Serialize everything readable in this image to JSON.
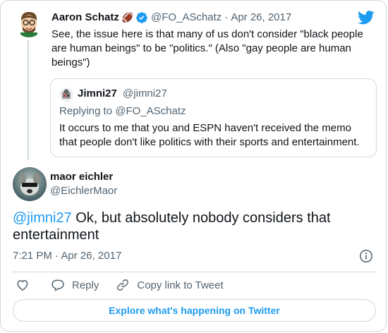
{
  "parent_tweet": {
    "author_name": "Aaron Schatz",
    "author_emoji": "🏈",
    "verified": true,
    "handle": "@FO_ASchatz",
    "separator": "·",
    "date": "Apr 26, 2017",
    "text": "See, the issue here is that many of us don't consider \"black people are human beings\" to be \"politics.\" (Also \"gay people are human beings\")"
  },
  "quoted_tweet": {
    "author_name": "Jimni27",
    "handle": "@jimni27",
    "replying_prefix": "Replying to",
    "replying_to": "@FO_ASchatz",
    "text": "It occurs to me that you and ESPN haven't received the memo that people don't like politics with their sports and entertainment."
  },
  "main_tweet": {
    "author_name": "maor eichler",
    "handle": "@EichlerMaor",
    "mention": "@jimni27",
    "text": " Ok, but absolutely nobody considers that entertainment",
    "time": "7:21 PM",
    "separator": "·",
    "date": "Apr 26, 2017"
  },
  "actions": {
    "reply_label": "Reply",
    "copy_link_label": "Copy link to Tweet"
  },
  "explore_label": "Explore what's happening on Twitter",
  "colors": {
    "accent": "#1d9bf0",
    "text": "#0f1419",
    "muted": "#536471",
    "border": "#cfd9de"
  },
  "icons": [
    "twitter-bird-icon",
    "verified-badge-icon",
    "info-icon",
    "heart-icon",
    "reply-icon",
    "link-icon"
  ]
}
